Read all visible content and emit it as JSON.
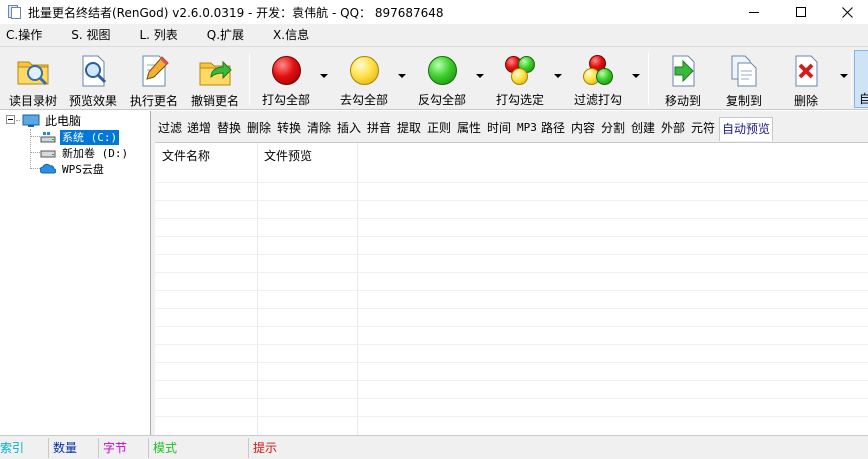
{
  "window": {
    "title": "批量更名终结者(RenGod) v2.6.0.0319 - 开发：袁伟航 - QQ： 897687648"
  },
  "menubar": [
    {
      "label": "C.操作"
    },
    {
      "label": "S. 视图"
    },
    {
      "label": "L. 列表"
    },
    {
      "label": "Q.扩展"
    },
    {
      "label": "X.信息"
    }
  ],
  "toolbar": {
    "buttons": [
      {
        "label": "读目录树",
        "icon": "folder-search-icon"
      },
      {
        "label": "预览效果",
        "icon": "magnifier-doc-icon"
      },
      {
        "label": "执行更名",
        "icon": "pencil-doc-icon"
      },
      {
        "label": "撤销更名",
        "icon": "undo-folder-icon"
      },
      {
        "label": "打勾全部",
        "icon": "red-circle-icon"
      },
      {
        "label": "去勾全部",
        "icon": "yellow-circle-icon"
      },
      {
        "label": "反勾全部",
        "icon": "green-circle-icon"
      },
      {
        "label": "打勾选定",
        "icon": "tricolor-circles-icon"
      },
      {
        "label": "过滤打勾",
        "icon": "tricolor-filter-icon"
      },
      {
        "label": "移动到",
        "icon": "move-arrow-icon"
      },
      {
        "label": "复制到",
        "icon": "copy-docs-icon"
      },
      {
        "label": "删除",
        "icon": "delete-x-icon"
      },
      {
        "label": "自",
        "icon": "auto-icon"
      }
    ]
  },
  "tree": {
    "root": "此电脑",
    "items": [
      {
        "label": "系统 (C:)",
        "selected": true
      },
      {
        "label": "新加卷 (D:)",
        "selected": false
      },
      {
        "label": "WPS云盘",
        "selected": false
      }
    ]
  },
  "function_tabs": [
    "过滤",
    "递增",
    "替换",
    "删除",
    "转换",
    "清除",
    "插入",
    "拼音",
    "提取",
    "正则",
    "属性",
    "时间",
    "MP3",
    "路径",
    "内容",
    "分割",
    "创建",
    "外部",
    "元符",
    "自动预览"
  ],
  "active_tab": "自动预览",
  "file_list": {
    "columns": [
      "文件名称",
      "文件预览"
    ]
  },
  "statusbar": {
    "fields": [
      {
        "label": "索引",
        "color": "#00b0c8"
      },
      {
        "label": "数量",
        "color": "#0030a0"
      },
      {
        "label": "字节",
        "color": "#d000d0"
      },
      {
        "label": "模式",
        "color": "#20c020"
      },
      {
        "label": "提示",
        "color": "#d01010"
      }
    ]
  }
}
